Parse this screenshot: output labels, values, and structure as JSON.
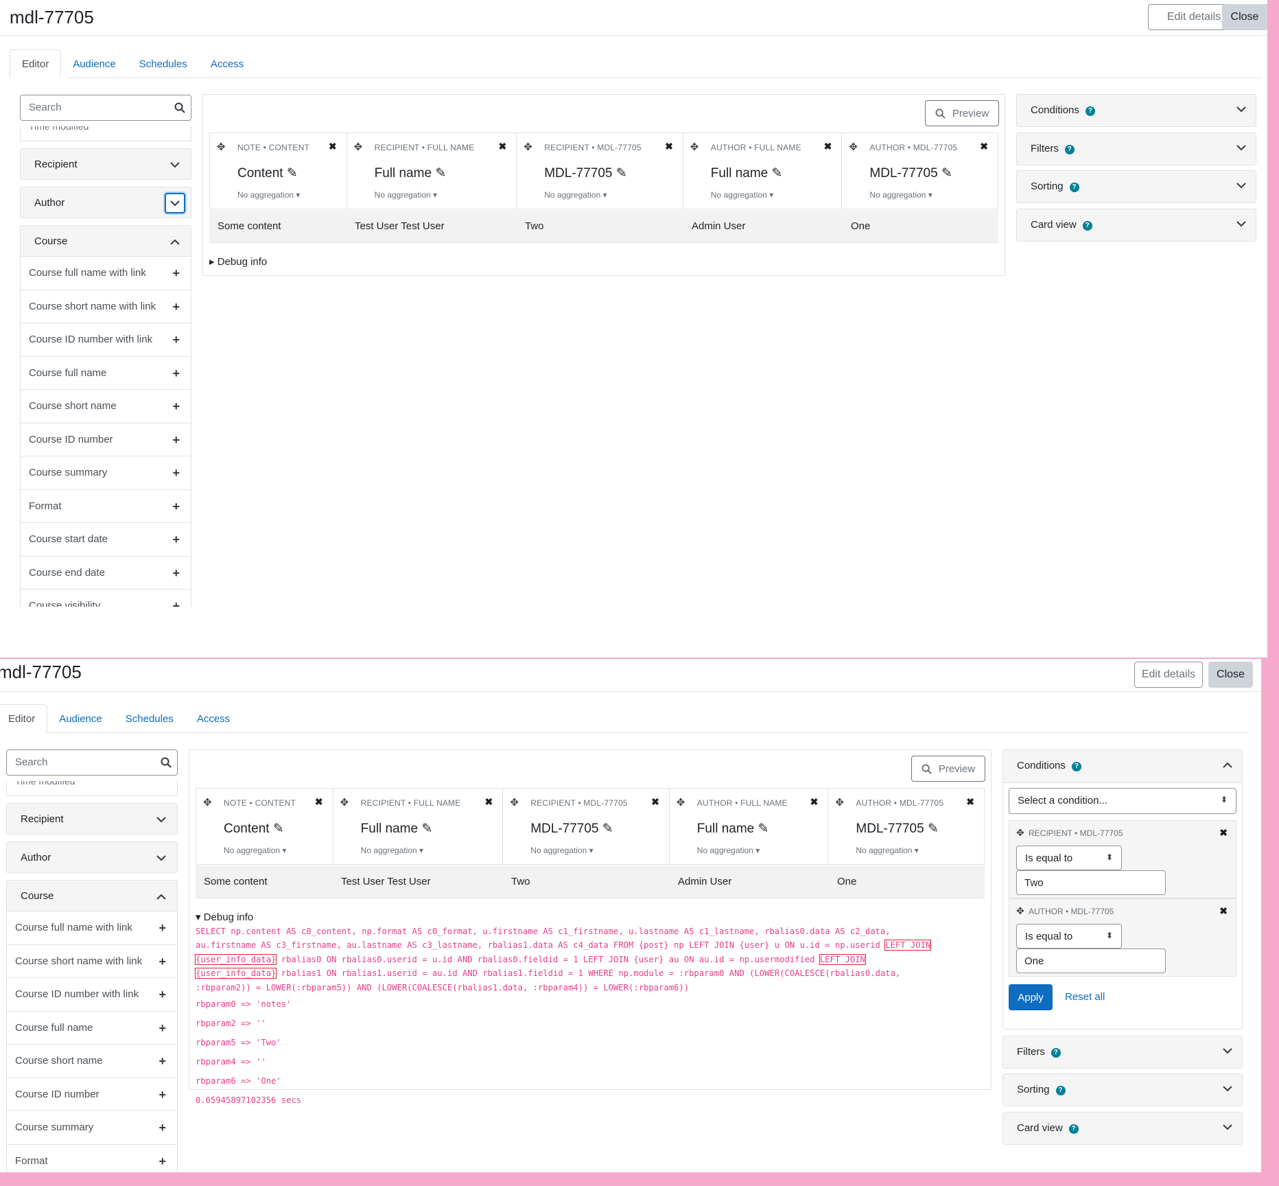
{
  "page": {
    "title": "mdl-77705",
    "edit_details": "Edit details",
    "close": "Close"
  },
  "tabs": [
    "Editor",
    "Audience",
    "Schedules",
    "Access"
  ],
  "sidebar": {
    "search_placeholder": "Search",
    "clipped_item": "Time modified",
    "categories": {
      "recipient": "Recipient",
      "author": "Author",
      "course": "Course"
    },
    "course_fields_top": [
      "Course full name with link",
      "Course short name with link",
      "Course ID number with link",
      "Course full name",
      "Course short name",
      "Course ID number",
      "Course summary",
      "Format",
      "Course start date",
      "Course end date",
      "Course visibility"
    ],
    "course_fields_bottom": [
      "Course full name with link",
      "Course short name with link",
      "Course ID number with link",
      "Course full name",
      "Course short name",
      "Course ID number",
      "Course summary",
      "Format"
    ]
  },
  "main": {
    "preview": "Preview",
    "columns": [
      {
        "caption": "NOTE • CONTENT",
        "name": "Content",
        "aggregation": "No aggregation"
      },
      {
        "caption": "RECIPIENT • FULL NAME",
        "name": "Full name",
        "aggregation": "No aggregation"
      },
      {
        "caption": "RECIPIENT • MDL-77705",
        "name": "MDL-77705",
        "aggregation": "No aggregation"
      },
      {
        "caption": "AUTHOR • FULL NAME",
        "name": "Full name",
        "aggregation": "No aggregation"
      },
      {
        "caption": "AUTHOR • MDL-77705",
        "name": "MDL-77705",
        "aggregation": "No aggregation"
      }
    ],
    "row": [
      "Some content",
      "Test User Test User",
      "Two",
      "Admin User",
      "One"
    ],
    "debug_label": "Debug info",
    "sql": {
      "line1": "SELECT np.content AS c0_content, np.format AS c0_format, u.firstname AS c1_firstname, u.lastname AS c1_lastname, rbalias0.data AS c2_data,",
      "line2a": "au.firstname AS c3_firstname, au.lastname AS c3_lastname, rbalias1.data AS c4_data FROM {post} np LEFT JOIN {user} u ON u.id = np.userid ",
      "line2b": "LEFT JOIN",
      "line3a": "{user_info_data}",
      "line3b": " rbalias0 ON rbalias0.userid = u.id AND rbalias0.fieldid = 1 LEFT JOIN {user} au ON au.id = np.usermodified ",
      "line3c": "LEFT JOIN",
      "line4a": "{user_info_data}",
      "line4b": " rbalias1 ON rbalias1.userid = au.id AND rbalias1.fieldid = 1 WHERE np.module = :rbparam0 AND (LOWER(COALESCE(rbalias0.data,",
      "line5": ":rbparam2)) = LOWER(:rbparam5)) AND (LOWER(COALESCE(rbalias1.data, :rbparam4)) = LOWER(:rbparam6))"
    },
    "params": [
      "rbparam0 => 'notes'",
      "rbparam2 => ''",
      "rbparam5 => 'Two'",
      "rbparam4 => ''",
      "rbparam6 => 'One'",
      "0.05945897102356 secs"
    ]
  },
  "right": {
    "conditions": "Conditions",
    "filters": "Filters",
    "sorting": "Sorting",
    "card_view": "Card view",
    "select_condition": "Select a condition...",
    "cond1": {
      "caption": "RECIPIENT • MDL-77705",
      "operator": "Is equal to",
      "value": "Two"
    },
    "cond2": {
      "caption": "AUTHOR • MDL-77705",
      "operator": "Is equal to",
      "value": "One"
    },
    "apply": "Apply",
    "reset_all": "Reset all"
  }
}
